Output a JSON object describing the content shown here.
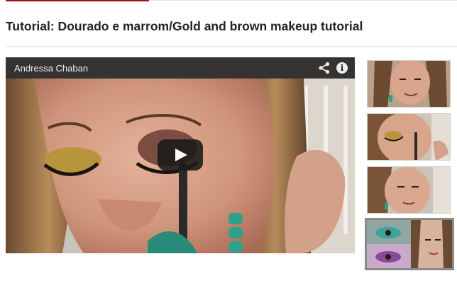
{
  "post": {
    "title": "Tutorial: Dourado e marrom/Gold and brown makeup tutorial"
  },
  "player": {
    "channel": "Andressa Chaban",
    "icons": [
      "share-icon",
      "info-icon",
      "play-icon"
    ],
    "info_glyph": "i"
  },
  "thumbnails": [
    {
      "name": "thumbnail-1",
      "active": false
    },
    {
      "name": "thumbnail-2",
      "active": false
    },
    {
      "name": "thumbnail-3",
      "active": false
    },
    {
      "name": "thumbnail-4",
      "active": true
    }
  ],
  "colors": {
    "accent": "#a8131a",
    "title_text": "#222222",
    "player_bar": "#141414"
  }
}
